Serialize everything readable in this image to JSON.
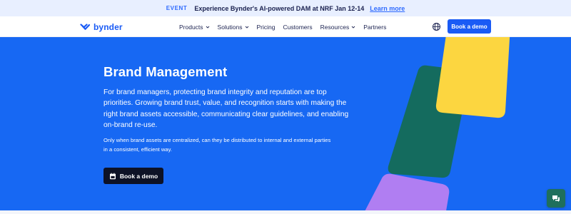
{
  "announcement": {
    "tag": "EVENT",
    "message": "Experience Bynder's AI-powered DAM at NRF Jan 12-14",
    "link": "Learn more"
  },
  "nav": {
    "logo": "bynder",
    "items": [
      {
        "label": "Products",
        "has_dropdown": true
      },
      {
        "label": "Solutions",
        "has_dropdown": true
      },
      {
        "label": "Pricing",
        "has_dropdown": false
      },
      {
        "label": "Customers",
        "has_dropdown": false
      },
      {
        "label": "Resources",
        "has_dropdown": true
      },
      {
        "label": "Partners",
        "has_dropdown": false
      }
    ],
    "cta": "Book a demo",
    "icons": {
      "language": "globe-icon",
      "dropdown": "chevron-down-icon"
    }
  },
  "hero": {
    "title": "Brand Management",
    "lead": "For brand managers, protecting brand integrity and reputation are top priorities. Growing brand trust, value, and recognition starts with making the right brand assets accessible, communicating clear guidelines, and enabling on-brand re-use.",
    "sub": "Only when brand assets are centralized, can they be distributed to internal and external parties in a consistent, efficient way.",
    "cta": "Book a demo",
    "cta_icon": "calendar-icon"
  },
  "chat": {
    "icon": "chat-icon"
  },
  "colors": {
    "brand_blue": "#1a5bf5",
    "hero_bg": "#1768f3",
    "yellow_shape": "#fcd640",
    "green_shape": "#146b5e",
    "purple_shape": "#b07ef2",
    "dark_button": "#0d1226"
  }
}
